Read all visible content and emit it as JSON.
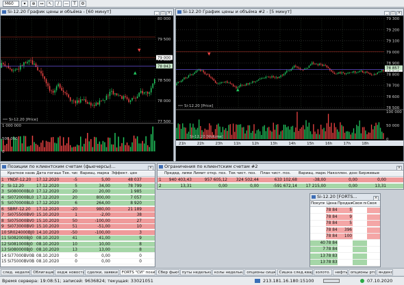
{
  "toolbar": {
    "selector": "M60"
  },
  "chart1": {
    "title": "Si-12.20 График цены и объёма - [60 минут]",
    "yticks": [
      "80 000",
      "79 500",
      "79 000",
      "78 500",
      "78 000",
      "77 500"
    ],
    "price_labels": [
      "79 000",
      "78 843"
    ],
    "legend": "Si-12.20 [Price]",
    "vol_ticks": [
      "1 000 000",
      "500 000",
      "0"
    ]
  },
  "chart2": {
    "title": "Si-12.20 График цены и объёма #2 - [5 минут]",
    "yticks": [
      "79 300",
      "79 200",
      "79 100",
      "79 000",
      "78 900",
      "78 800",
      "78 700",
      "78 600",
      "78 500"
    ],
    "price_labels": [
      "78 843",
      "78 857"
    ],
    "legend": "Si-12.20 [Price]",
    "vol_ticks": [
      "100 000",
      "50 000",
      "0"
    ],
    "vol_legend": "Si-12.20 [Volume]",
    "xticks": [
      "21h",
      "22h",
      "23h",
      "11h",
      "12h",
      "13h",
      "14h",
      "15h",
      "16h",
      "17h",
      "18h"
    ]
  },
  "positions": {
    "title": "Позиции по клиентским счетам (фьючерсы)...",
    "headers": [
      "Краткое название",
      "Дата погаше",
      "Тек. чист",
      "Вариац. марка",
      "Эффект. цен"
    ],
    "rows": [
      {
        "name": "YNDF-12.20",
        "date": "17.12.2020",
        "qty": "-5",
        "var": "5,00",
        "price": "48 037",
        "color": "#ef9a9a"
      },
      {
        "name": "Si-12.20",
        "date": "17.12.2020",
        "qty": "5",
        "var": "34,00",
        "price": "78 799",
        "color": "#a5d6a7"
      },
      {
        "name": "Si080000BL0",
        "date": "17.12.2020",
        "qty": "20",
        "var": "20,00",
        "price": "1 985",
        "color": "#a5d6a7"
      },
      {
        "name": "Si072000BL0",
        "date": "17.12.2020",
        "qty": "20",
        "var": "800,00",
        "price": "7 057",
        "color": "#a5d6a7"
      },
      {
        "name": "Si070000BL0",
        "date": "17.12.2020",
        "qty": "6",
        "var": "264,00",
        "price": "8 920",
        "color": "#a5d6a7"
      },
      {
        "name": "SBRF-12.20",
        "date": "17.12.2020",
        "qty": "-20",
        "var": "980,00",
        "price": "21 189",
        "color": "#ef9a9a"
      },
      {
        "name": "Si075500BV0",
        "date": "15.10.2020",
        "qty": "1",
        "var": "-2,00",
        "price": "38",
        "color": "#ef9a9a"
      },
      {
        "name": "Si075000BV0",
        "date": "15.10.2020",
        "qty": "50",
        "var": "-100,00",
        "price": "27",
        "color": "#ef9a9a"
      },
      {
        "name": "Si073000BV0",
        "date": "15.10.2020",
        "qty": "51",
        "var": "-51,00",
        "price": "10",
        "color": "#ef9a9a"
      },
      {
        "name": "SR024000BJ0",
        "date": "14.10.2020",
        "qty": "-50",
        "var": "-100,00",
        "price": "3",
        "color": "#ef9a9a"
      },
      {
        "name": "Si082000BJ0",
        "date": "08.10.2020",
        "qty": "41",
        "var": "41,00",
        "price": "9",
        "color": "#a5d6a7"
      },
      {
        "name": "Si081000BJ0",
        "date": "08.10.2020",
        "qty": "10",
        "var": "10,00",
        "price": "8",
        "color": "#a5d6a7"
      },
      {
        "name": "Si080000BJ0",
        "date": "08.10.2020",
        "qty": "13",
        "var": "13,00",
        "price": "8",
        "color": "#a5d6a7"
      },
      {
        "name": "Si77000BV0B",
        "date": "08.10.2020",
        "qty": "0",
        "var": "0,00",
        "price": "0",
        "color": "#ffffff"
      },
      {
        "name": "Si75000BV0B",
        "date": "08.10.2020",
        "qty": "0",
        "var": "0,00",
        "price": "0",
        "color": "#ffffff"
      }
    ]
  },
  "limits": {
    "title": "Ограничения по клиентским счетам #2",
    "headers": [
      "Предвд. лимит",
      "Лимит откр. поз.",
      "Тек чист. поз.",
      "План чист. поз.",
      "Вариац. марка",
      "Наколлен. доход",
      "Биржевые"
    ],
    "rows": [
      {
        "n": "1",
        "vals": [
          "940 403,43",
          "957 605,12",
          "324 502,44",
          "633 102,68",
          "-38,00",
          "0,00",
          "0,00"
        ],
        "color": "#ef9a9a"
      },
      {
        "n": "2",
        "vals": [
          "13,31",
          "0,00",
          "0,00",
          "-591 672,14",
          "17 215,00",
          "0,00",
          "13,31"
        ],
        "color": "#a5d6a7"
      }
    ]
  },
  "orderbook": {
    "title": "Si-12.20 [FORTS...",
    "headers": [
      "Покупка",
      "Цена",
      "Продажа",
      "Своя пок.",
      "Своя"
    ],
    "rows": [
      {
        "buy": "",
        "price": "78 849",
        "sell": "5",
        "side": "s"
      },
      {
        "buy": "",
        "price": "78 848",
        "sell": "9",
        "side": "s"
      },
      {
        "buy": "",
        "price": "78 847",
        "sell": "5",
        "side": "s"
      },
      {
        "buy": "",
        "price": "78 846",
        "sell": "396",
        "side": "s"
      },
      {
        "buy": "",
        "price": "78 845",
        "sell": "100",
        "side": "s"
      },
      {
        "buy": "40",
        "price": "78 844",
        "sell": "",
        "side": "b"
      },
      {
        "buy": "7",
        "price": "78 840",
        "sell": "",
        "side": "b"
      },
      {
        "buy": "13",
        "price": "78 839",
        "sell": "",
        "side": "b"
      },
      {
        "buy": "13",
        "price": "78 838",
        "sell": "",
        "side": "b"
      }
    ]
  },
  "tabs": [
    "след. неделя",
    "Облигации",
    "хедж новости",
    "сделки, заявки",
    "FORTS \"СИ\" позиции..",
    "Сбер фьюч",
    "путы неделька",
    "колы неделька",
    "опционы сишка",
    "Сишка след.квартал",
    "золото.",
    "нефть",
    "опционы ртс",
    "яндекс"
  ],
  "status": {
    "server_time": "Время сервера: 19:08:51; записей: 9636824; текущая: 33021051",
    "ip": "213.181.16.180:15100",
    "date": "07.10.2020"
  },
  "colors": {
    "up": "#22c55e",
    "down": "#ef4444",
    "bg": "#000000"
  }
}
